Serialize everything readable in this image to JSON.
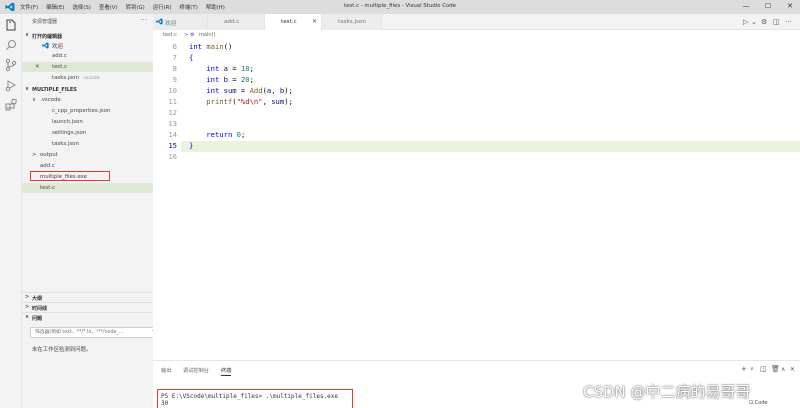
{
  "titlebar": {
    "menus": [
      "文件(F)",
      "编辑(E)",
      "选择(S)",
      "查看(V)",
      "转到(G)",
      "运行(R)",
      "终端(T)",
      "帮助(H)"
    ],
    "window_title": "test.c - multiple_files - Visual Studio Code",
    "min": "—",
    "max": "☐",
    "close": "✕"
  },
  "sidebar": {
    "title": "资源管理器",
    "more": "···",
    "open_editors_title": "打开的编辑器",
    "open_editors": [
      {
        "label": "欢迎",
        "hint": ""
      },
      {
        "label": "add.c",
        "hint": ""
      },
      {
        "label": "test.c",
        "hint": "",
        "close": "✕"
      },
      {
        "label": "tasks.json",
        "hint": ".vscode"
      }
    ],
    "project_title": "MULTIPLE_FILES",
    "tree": [
      {
        "label": ".vscode",
        "chevron": "∨"
      },
      {
        "label": "c_cpp_properties.json"
      },
      {
        "label": "launch.json"
      },
      {
        "label": "settings.json"
      },
      {
        "label": "tasks.json"
      },
      {
        "label": "output",
        "chevron": ">"
      },
      {
        "label": "add.c"
      },
      {
        "label": "multiple_files.exe"
      },
      {
        "label": "test.c"
      }
    ],
    "outline_title": "大纲",
    "timeline_title": "时间线",
    "problems_title": "问题",
    "filter_placeholder": "筛选器(例如 text、**/*.ts、!**/node_...",
    "problems_empty": "未在工作区检测到问题。"
  },
  "tabs": [
    {
      "label": "欢迎",
      "active": false
    },
    {
      "label": "add.c",
      "active": false
    },
    {
      "label": "test.c",
      "active": true,
      "close": "✕"
    },
    {
      "label": "tasks.json",
      "active": false
    }
  ],
  "breadcrumb": {
    "file": "test.c",
    "sep": ">",
    "symbol": "main()"
  },
  "editor": {
    "line_numbers": [
      "6",
      "7",
      "8",
      "9",
      "10",
      "11",
      "12",
      "13",
      "14",
      "15",
      "16"
    ],
    "current_line": "15",
    "lines": [
      {
        "tokens": [
          {
            "t": "int ",
            "c": "kw"
          },
          {
            "t": "main",
            "c": "fn"
          },
          {
            "t": "()",
            "c": ""
          }
        ]
      },
      {
        "tokens": [
          {
            "t": "{",
            "c": "kw"
          }
        ]
      },
      {
        "tokens": [
          {
            "t": "    int ",
            "c": "kw"
          },
          {
            "t": "a",
            "c": "var"
          },
          {
            "t": " = ",
            "c": ""
          },
          {
            "t": "10",
            "c": "num"
          },
          {
            "t": ";",
            "c": ""
          }
        ]
      },
      {
        "tokens": [
          {
            "t": "    int ",
            "c": "kw"
          },
          {
            "t": "b",
            "c": "var"
          },
          {
            "t": " = ",
            "c": ""
          },
          {
            "t": "20",
            "c": "num"
          },
          {
            "t": ";",
            "c": ""
          }
        ]
      },
      {
        "tokens": [
          {
            "t": "    int ",
            "c": "kw"
          },
          {
            "t": "sum",
            "c": "var"
          },
          {
            "t": " = ",
            "c": ""
          },
          {
            "t": "Add",
            "c": "fn"
          },
          {
            "t": "(",
            "c": ""
          },
          {
            "t": "a",
            "c": "var"
          },
          {
            "t": ", ",
            "c": ""
          },
          {
            "t": "b",
            "c": "var"
          },
          {
            "t": ");",
            "c": ""
          }
        ]
      },
      {
        "tokens": [
          {
            "t": "    printf",
            "c": "fn"
          },
          {
            "t": "(",
            "c": ""
          },
          {
            "t": "\"%d\\n\"",
            "c": "str"
          },
          {
            "t": ", ",
            "c": ""
          },
          {
            "t": "sum",
            "c": "var"
          },
          {
            "t": ");",
            "c": ""
          }
        ]
      },
      {
        "tokens": []
      },
      {
        "tokens": []
      },
      {
        "tokens": [
          {
            "t": "    return ",
            "c": "kw"
          },
          {
            "t": "0",
            "c": "num"
          },
          {
            "t": ";",
            "c": ""
          }
        ]
      },
      {
        "tokens": [
          {
            "t": "}",
            "c": "kw"
          }
        ]
      },
      {
        "tokens": []
      }
    ]
  },
  "panel": {
    "tabs": [
      "输出",
      "调试控制台",
      "终端"
    ],
    "active_tab": "终端",
    "add": "+",
    "terminal_prompt": "PS E:\\VScode\\multiple_files> .\\multiple_files.exe",
    "terminal_output": "30",
    "side_terminal_label": "Code"
  },
  "watermark": "CSDN @中二病的易哥哥",
  "colors": {
    "accent": "#007acc",
    "highlight_box": "#e23b2e",
    "current_line": "#eaf3dc"
  }
}
